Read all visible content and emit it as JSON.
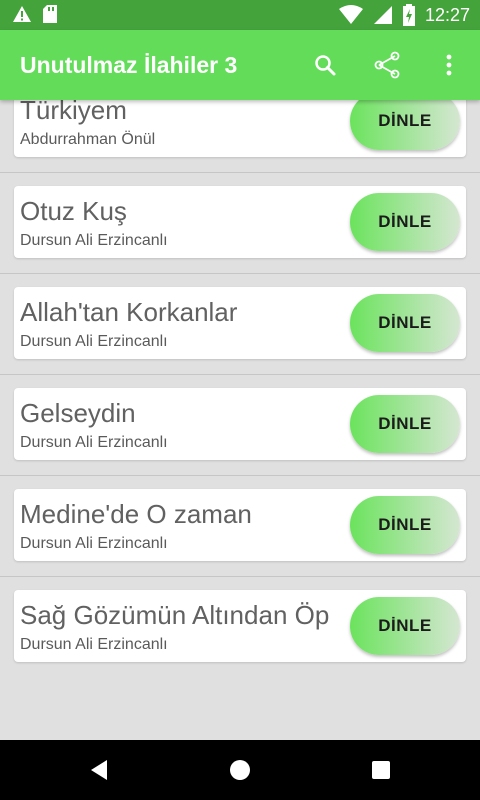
{
  "status_bar": {
    "time": "12:27"
  },
  "app_bar": {
    "title": "Unutulmaz İlahiler 3",
    "actions": [
      "search-icon",
      "share-icon",
      "more-vert-icon"
    ]
  },
  "songs": [
    {
      "title": "Türkiyem",
      "artist": "Abdurrahman Önül",
      "button": "DİNLE"
    },
    {
      "title": "Otuz Kuş",
      "artist": "Dursun Ali Erzincanlı",
      "button": "DİNLE"
    },
    {
      "title": "Allah'tan Korkanlar",
      "artist": "Dursun Ali Erzincanlı",
      "button": "DİNLE"
    },
    {
      "title": "Gelseydin",
      "artist": "Dursun Ali Erzincanlı",
      "button": "DİNLE"
    },
    {
      "title": "Medine'de O zaman",
      "artist": "Dursun Ali Erzincanlı",
      "button": "DİNLE"
    },
    {
      "title": "Sağ Gözümün Altından Öp",
      "artist": "Dursun Ali Erzincanlı",
      "button": "DİNLE"
    }
  ],
  "colors": {
    "app_bar": "#63dc5a",
    "status_bar": "#45a33c",
    "background": "#e0e0e0",
    "button_start": "#6be35d"
  }
}
